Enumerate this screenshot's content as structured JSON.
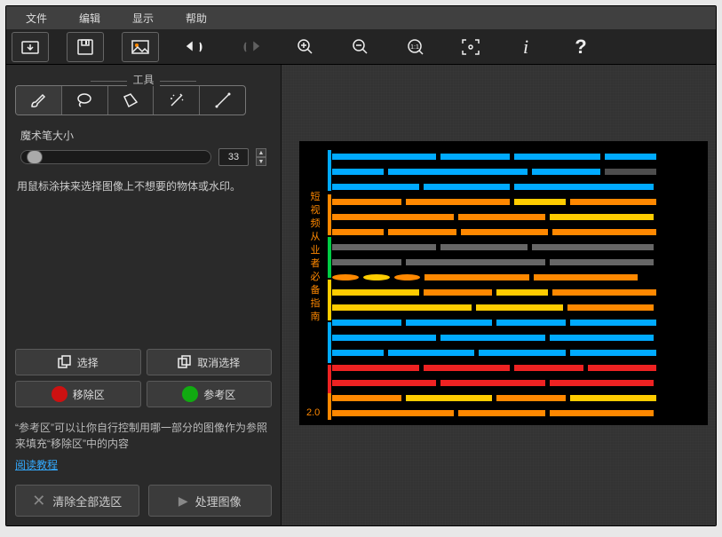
{
  "menu": {
    "file": "文件",
    "edit": "编辑",
    "view": "显示",
    "help": "帮助"
  },
  "tools_label": "工具",
  "brush": {
    "label": "魔术笔大小",
    "value": "33"
  },
  "help_text": "用鼠标涂抹来选择图像上不想要的物体或水印。",
  "select_btn": "选择",
  "deselect_btn": "取消选择",
  "remove_btn": "移除区",
  "ref_btn": "参考区",
  "info_text": "“参考区”可以让你自行控制用哪一部分的图像作为参照来填充“移除区”中的内容",
  "link": "阅读教程",
  "clear_btn": "清除全部选区",
  "process_btn": "处理图像",
  "vtxt": "短视频从业者必备指南",
  "bl": "2.0"
}
